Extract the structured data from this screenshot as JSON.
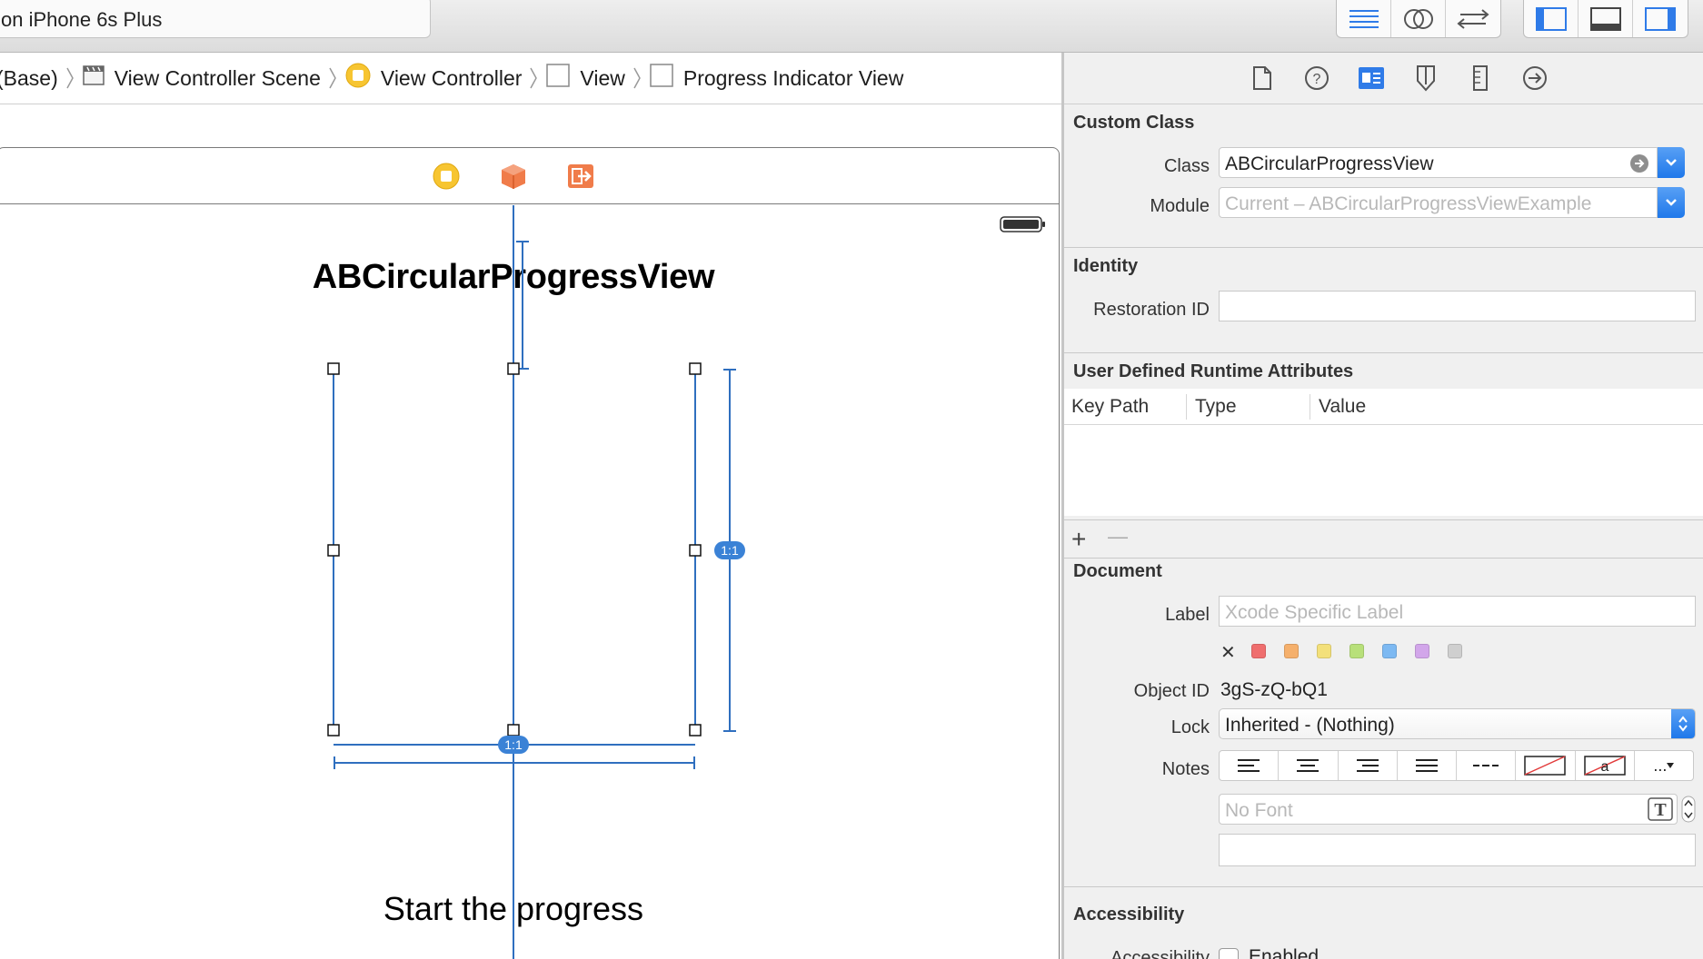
{
  "toolbar": {
    "scheme_text": "on iPhone 6s Plus",
    "editor_buttons": [
      "standard-editor-icon",
      "assistant-editor-icon",
      "version-editor-icon"
    ],
    "view_buttons": [
      "navigator-toggle-icon",
      "debug-area-toggle-icon",
      "utilities-toggle-icon"
    ]
  },
  "jumpbar": {
    "items": [
      {
        "label": "(Base)",
        "icon": "none"
      },
      {
        "label": "View Controller Scene",
        "icon": "scene-icon"
      },
      {
        "label": "View Controller",
        "icon": "view-controller-icon"
      },
      {
        "label": "View",
        "icon": "view-icon"
      },
      {
        "label": "Progress Indicator View",
        "icon": "view-icon"
      }
    ]
  },
  "canvas": {
    "scene_title": "ABCircularProgressView",
    "button_label": "Start the progress",
    "ratio_badge_vertical": "1:1",
    "ratio_badge_horizontal": "1:1"
  },
  "inspector": {
    "tabs": [
      "file-inspector-icon",
      "quick-help-icon",
      "identity-inspector-icon",
      "attributes-inspector-icon",
      "size-inspector-icon",
      "connections-inspector-icon"
    ],
    "custom_class": {
      "title": "Custom Class",
      "class_label": "Class",
      "class_value": "ABCircularProgressView",
      "module_label": "Module",
      "module_placeholder": "Current – ABCircularProgressViewExample"
    },
    "identity": {
      "title": "Identity",
      "restoration_label": "Restoration ID",
      "restoration_value": ""
    },
    "runtime_attributes": {
      "title": "User Defined Runtime Attributes",
      "columns": [
        "Key Path",
        "Type",
        "Value"
      ],
      "add_symbol": "+",
      "remove_symbol": "—"
    },
    "document": {
      "title": "Document",
      "label_label": "Label",
      "label_placeholder": "Xcode Specific Label",
      "clear_symbol": "✕",
      "swatch_colors": [
        "#ef6e6e",
        "#f5b06c",
        "#f3e07a",
        "#b8e07a",
        "#7db9f2",
        "#d2a6ea",
        "#cfcfcf"
      ],
      "object_id_label": "Object ID",
      "object_id_value": "3gS-zQ-bQ1",
      "lock_label": "Lock",
      "lock_value": "Inherited - (Nothing)",
      "notes_label": "Notes",
      "font_placeholder": "No Font",
      "notes_text_sample": "a",
      "notes_more": "..."
    },
    "accessibility": {
      "title": "Accessibility",
      "row_label": "Accessibility",
      "enabled_label": "Enabled"
    }
  },
  "colors": {
    "accent": "#1f78ea",
    "constraint_blue": "#2f6fbf",
    "badge_blue": "#3b82d6"
  }
}
